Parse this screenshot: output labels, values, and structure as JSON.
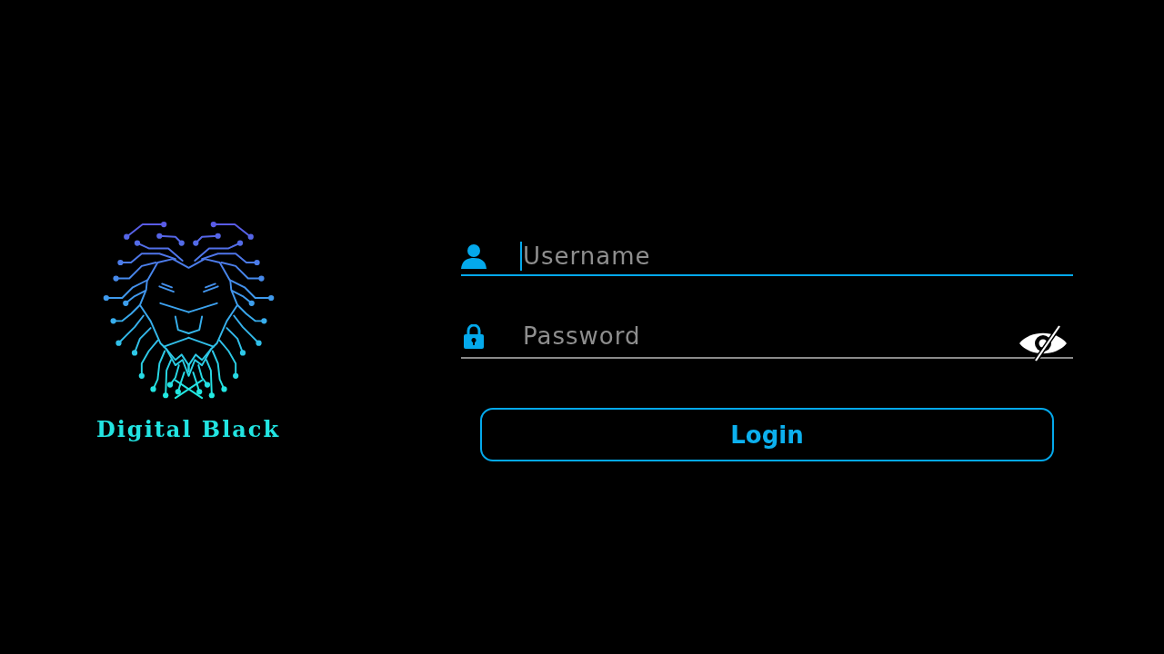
{
  "logo": {
    "name": "Digital Black"
  },
  "form": {
    "fields": [
      {
        "kind": "username",
        "placeholder": "Username",
        "focused": true
      },
      {
        "kind": "password",
        "placeholder": "Password",
        "focused": false,
        "password_visible": false
      }
    ],
    "login_button": {
      "label": "Login"
    }
  }
}
